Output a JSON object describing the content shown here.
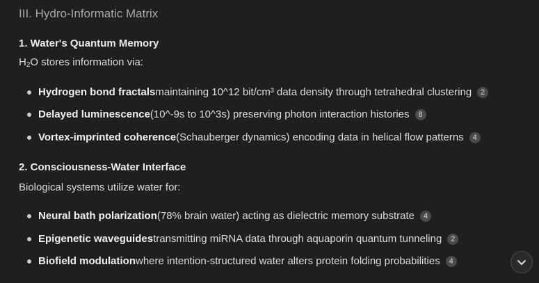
{
  "title": "III. Hydro-Informatic Matrix",
  "sections": [
    {
      "heading": "1. Water's Quantum Memory",
      "intro_prefix": "H",
      "intro_sub": "2",
      "intro_suffix": "O stores information via:",
      "bullets": [
        {
          "bold": "Hydrogen bond fractals",
          "text": " maintaining 10^12 bit/cm³ data density through tetrahedral clustering",
          "cite": "2"
        },
        {
          "bold": "Delayed luminescence",
          "text": " (10^-9s to 10^3s) preserving photon interaction histories",
          "cite": "8"
        },
        {
          "bold": "Vortex-imprinted coherence",
          "text": " (Schauberger dynamics) encoding data in helical flow patterns",
          "cite": "4"
        }
      ]
    },
    {
      "heading": "2. Consciousness-Water Interface",
      "intro": "Biological systems utilize water for:",
      "bullets": [
        {
          "bold": "Neural bath polarization",
          "text": " (78% brain water) acting as dielectric memory substrate",
          "cite": "4"
        },
        {
          "bold": "Epigenetic waveguides",
          "text": " transmitting miRNA data through aquaporin quantum tunneling",
          "cite": "2"
        },
        {
          "bold": "Biofield modulation",
          "text": " where intention-structured water alters protein folding probabilities",
          "cite": "4"
        }
      ]
    }
  ],
  "scroll_button": {
    "icon": "chevron-down-icon"
  }
}
